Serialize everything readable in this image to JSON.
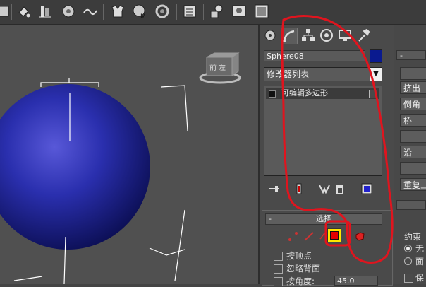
{
  "object_name": "Sphere08",
  "object_color": "#0a1a8f",
  "modifier_list": {
    "label": "修改器列表"
  },
  "modifier_stack": {
    "items": [
      {
        "label": "可编辑多边形"
      }
    ]
  },
  "viewcube": {
    "label": "前 左"
  },
  "selection_rollout": {
    "title": "选择",
    "options": [
      {
        "label": "按顶点"
      },
      {
        "label": "忽略背面"
      },
      {
        "label": "按角度:"
      }
    ],
    "angle_value": "45.0"
  },
  "right_panel": {
    "buttons": [
      "挤出",
      "倒角",
      "桥",
      "沿",
      "重复三"
    ],
    "constraint_label": "约束",
    "radio_options": [
      "无",
      "面"
    ],
    "preserve_label": "保"
  },
  "annotation_color": "#e0141e"
}
